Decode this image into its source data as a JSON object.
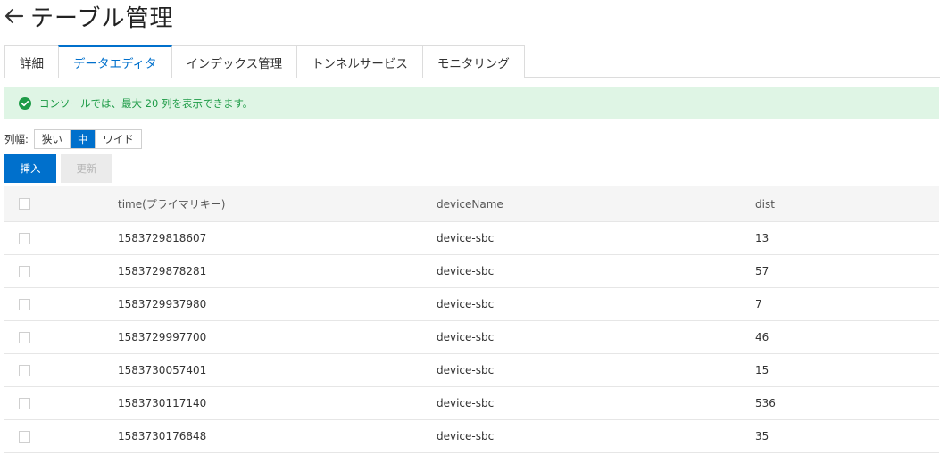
{
  "header": {
    "title": "テーブル管理"
  },
  "tabs": [
    {
      "label": "詳細"
    },
    {
      "label": "データエディタ"
    },
    {
      "label": "インデックス管理"
    },
    {
      "label": "トンネルサービス"
    },
    {
      "label": "モニタリング"
    }
  ],
  "active_tab": "データエディタ",
  "alert": {
    "text": "コンソールでは、最大 20 列を表示できます。"
  },
  "column_width": {
    "label": "列幅:",
    "options": [
      "狭い",
      "中",
      "ワイド"
    ],
    "selected": "中"
  },
  "actions": {
    "insert": "挿入",
    "update": "更新"
  },
  "table": {
    "columns": [
      "time(プライマリキー)",
      "deviceName",
      "dist"
    ],
    "rows": [
      [
        "1583729818607",
        "device-sbc",
        "13"
      ],
      [
        "1583729878281",
        "device-sbc",
        "57"
      ],
      [
        "1583729937980",
        "device-sbc",
        "7"
      ],
      [
        "1583729997700",
        "device-sbc",
        "46"
      ],
      [
        "1583730057401",
        "device-sbc",
        "15"
      ],
      [
        "1583730117140",
        "device-sbc",
        "536"
      ],
      [
        "1583730176848",
        "device-sbc",
        "35"
      ]
    ]
  },
  "colors": {
    "accent": "#0070cc",
    "success": "#1e9b47",
    "success_bg": "#dff5e5"
  }
}
